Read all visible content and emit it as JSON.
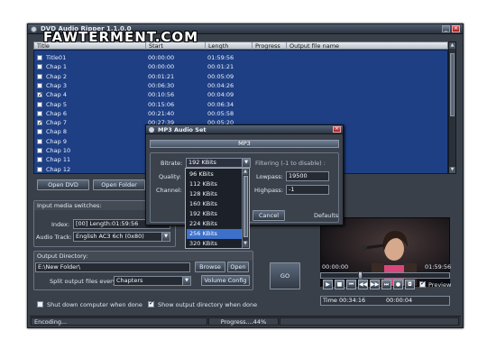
{
  "app": {
    "title": "DVD Audio Ripper 1.1.0.0",
    "watermark": "FAWTERMENT.COM",
    "icons": {
      "app": "disc-icon",
      "minimize": "minimize-icon",
      "close": "close-icon"
    }
  },
  "table": {
    "columns": [
      "Title",
      "Start",
      "Length",
      "Progress",
      "Output file name"
    ],
    "rows": [
      {
        "name": "Title01",
        "start": "00:00:00",
        "length": "01:59:56",
        "checked": false
      },
      {
        "name": "Chap 1",
        "start": "00:00:00",
        "length": "00:01:21",
        "checked": false
      },
      {
        "name": "Chap 2",
        "start": "00:01:21",
        "length": "00:05:09",
        "checked": false
      },
      {
        "name": "Chap 3",
        "start": "00:06:30",
        "length": "00:04:26",
        "checked": false
      },
      {
        "name": "Chap 4",
        "start": "00:10:56",
        "length": "00:04:09",
        "checked": true
      },
      {
        "name": "Chap 5",
        "start": "00:15:06",
        "length": "00:06:34",
        "checked": false
      },
      {
        "name": "Chap 6",
        "start": "00:21:40",
        "length": "00:05:58",
        "checked": false
      },
      {
        "name": "Chap 7",
        "start": "00:27:39",
        "length": "00:05:20",
        "checked": true
      },
      {
        "name": "Chap 8",
        "start": "",
        "length": "",
        "checked": false
      },
      {
        "name": "Chap 9",
        "start": "",
        "length": "",
        "checked": false
      },
      {
        "name": "Chap 10",
        "start": "",
        "length": "",
        "checked": false
      },
      {
        "name": "Chap 11",
        "start": "",
        "length": "",
        "checked": false
      },
      {
        "name": "Chap 12",
        "start": "",
        "length": "",
        "checked": false
      }
    ]
  },
  "buttons": {
    "open_dvd": "Open DVD",
    "open_folder": "Open Folder",
    "browse": "Browse",
    "open": "Open",
    "volume_config": "Volume Config",
    "go": "GO"
  },
  "input_media": {
    "title": "Input media switches:",
    "index_label": "Index:",
    "index_value": "[00] Length:01:59:56",
    "audio_track_label": "Audio Track:",
    "audio_track_value": "English AC3 6ch (0x80)"
  },
  "output": {
    "title": "Output Directory:",
    "directory": "E:\\New Folder\\",
    "split_label": "Split output files every:",
    "split_value": "Chapters"
  },
  "options": {
    "shutdown_label": "Shut down computer when done",
    "shutdown_checked": false,
    "show_dir_label": "Show output directory when done",
    "show_dir_checked": true
  },
  "player": {
    "time_start": "00:00:00",
    "time_end": "01:59:56",
    "position_fraction": 0.3,
    "preview_label": "Preview",
    "preview_checked": true,
    "time_label": "Time 00:34:16",
    "elapsed": "00:00:04",
    "controls": [
      {
        "icon": "play-icon",
        "glyph": "▶"
      },
      {
        "icon": "stop-icon",
        "glyph": "■"
      },
      {
        "icon": "start-icon",
        "glyph": "⏮"
      },
      {
        "icon": "rewind-icon",
        "glyph": "◀◀"
      },
      {
        "icon": "forward-icon",
        "glyph": "▶▶"
      },
      {
        "icon": "end-icon",
        "glyph": "⏭"
      },
      {
        "icon": "record-icon",
        "glyph": "●"
      },
      {
        "icon": "snapshot-icon",
        "glyph": "◘"
      }
    ]
  },
  "status": {
    "state": "Encoding...",
    "progress": "Progress....44%"
  },
  "dialog": {
    "title": "MP3 Audio Set",
    "section": "MP3",
    "bitrate_label": "Bitrate:",
    "bitrate_value": "192 KBits",
    "quality_label": "Quality:",
    "channel_label": "Channel:",
    "filtering_label": "Filtering (-1 to disable) :",
    "lowpass_label": "Lowpass:",
    "lowpass_value": "19500",
    "highpass_label": "Highpass:",
    "highpass_value": "-1",
    "cancel": "Cancel",
    "defaults": "Defaults",
    "bitrate_options": [
      "96 KBits",
      "112 KBits",
      "128 KBits",
      "160 KBits",
      "192 KBits",
      "224 KBits",
      "256 KBits",
      "320 KBits"
    ],
    "selected_option": "256 KBits"
  }
}
